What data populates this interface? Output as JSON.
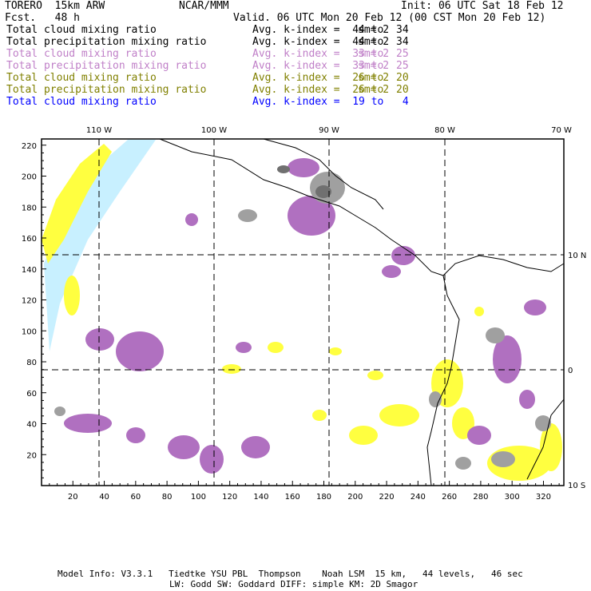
{
  "header": {
    "model": "TORERO  15km ARW",
    "org": "NCAR/MMM",
    "init": "Init: 06 UTC Sat 18 Feb 12",
    "fcst": "Fcst.   48 h",
    "valid": "Valid. 06 UTC Mon 20 Feb 12 (00 CST Mon 20 Feb 12)"
  },
  "legend": [
    {
      "field": "Total cloud mixing ratio",
      "range": "Avg. k-index =  44 to  34",
      "sm": "sm= 2",
      "color": "#000000"
    },
    {
      "field": "Total precipitation mixing ratio",
      "range": "Avg. k-index =  44 to  34",
      "sm": "sm= 2",
      "color": "#000000"
    },
    {
      "field": "Total cloud mixing ratio",
      "range": "Avg. k-index =  33 to  25",
      "sm": "sm= 2",
      "color": "#c080c8"
    },
    {
      "field": "Total precipitation mixing ratio",
      "range": "Avg. k-index =  33 to  25",
      "sm": "sm= 2",
      "color": "#c080c8"
    },
    {
      "field": "Total cloud mixing ratio",
      "range": "Avg. k-index =  26 to  20",
      "sm": "sm= 2",
      "color": "#808000"
    },
    {
      "field": "Total precipitation mixing ratio",
      "range": "Avg. k-index =  26 to  20",
      "sm": "sm= 2",
      "color": "#808000"
    },
    {
      "field": "Total cloud mixing ratio",
      "range": "Avg. k-index =  19 to   4",
      "sm": "",
      "color": "#0000ff"
    }
  ],
  "chart_data": {
    "type": "heatmap",
    "x_ticks": [
      "20",
      "40",
      "60",
      "80",
      "100",
      "120",
      "140",
      "160",
      "180",
      "200",
      "220",
      "240",
      "260",
      "280",
      "300",
      "320"
    ],
    "y_ticks": [
      "20",
      "40",
      "60",
      "80",
      "100",
      "120",
      "140",
      "160",
      "180",
      "200",
      "220"
    ],
    "xlim": [
      0,
      333
    ],
    "ylim": [
      0,
      224
    ],
    "lon_labels": [
      "110 W",
      "100 W",
      "90 W",
      "80 W",
      "70 W"
    ],
    "lat_labels": [
      "10 N",
      "0",
      "10 S"
    ],
    "grid": true,
    "colors": {
      "level1": "#a0a0a0",
      "level2": "#b070c0",
      "level3": "#ffff40",
      "level4": "#c8f0ff"
    }
  },
  "footer": {
    "line1": "Model Info: V3.3.1   Tiedtke YSU PBL  Thompson    Noah LSM  15 km,   44 levels,   46 sec",
    "line2": "LW: Godd SW: Goddard DIFF: simple KM: 2D Smagor"
  }
}
